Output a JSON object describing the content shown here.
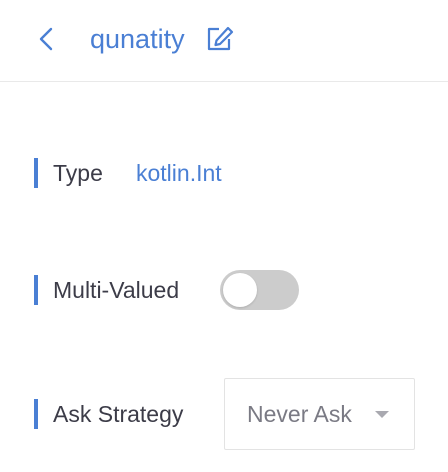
{
  "header": {
    "title": "qunatity",
    "back_icon": "chevron-left-icon",
    "edit_icon": "edit-icon"
  },
  "rows": {
    "type": {
      "label": "Type",
      "value": "kotlin.Int"
    },
    "multi_valued": {
      "label": "Multi-Valued",
      "enabled": false
    },
    "ask_strategy": {
      "label": "Ask Strategy",
      "selected": "Never Ask"
    }
  },
  "colors": {
    "accent": "#4a7fd4",
    "label_text": "#3c3c48",
    "toggle_off": "#cccccc",
    "select_text": "#7a7a84"
  }
}
